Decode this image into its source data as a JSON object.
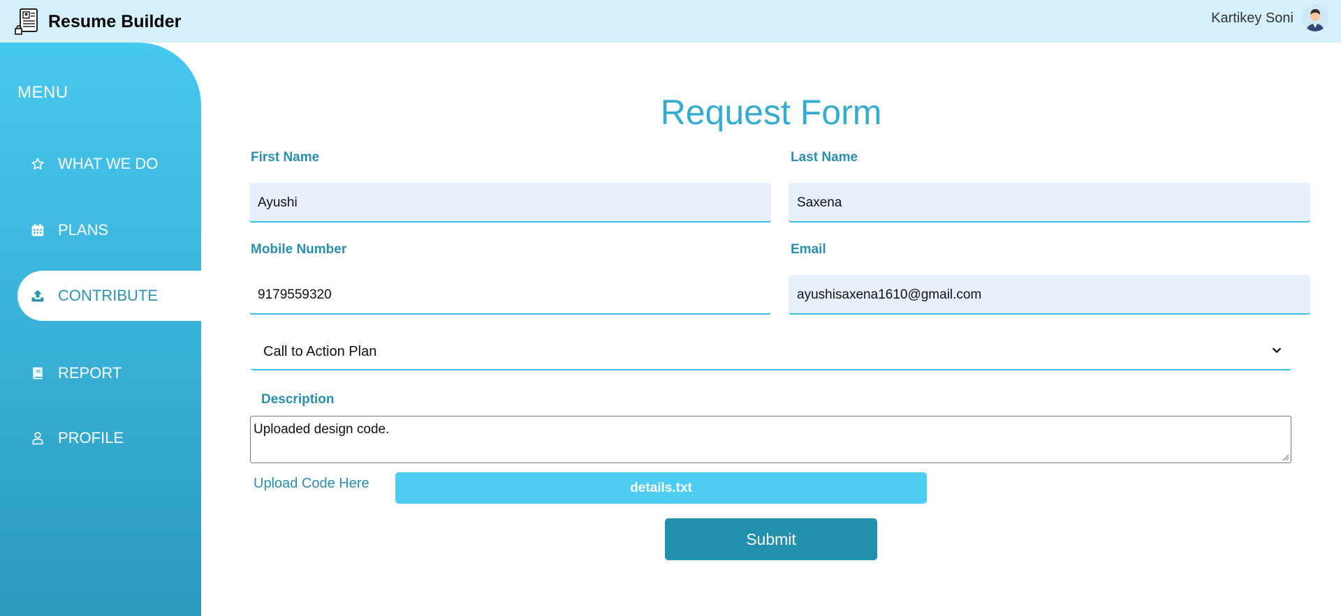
{
  "header": {
    "brand_title": "Resume Builder",
    "user_name": "Kartikey Soni",
    "background": "#d4f0fb"
  },
  "sidebar": {
    "menu_title": "MENU",
    "items": [
      {
        "label": "WHAT WE DO",
        "icon": "star-icon",
        "active": false
      },
      {
        "label": "PLANS",
        "icon": "calendar-icon",
        "active": false
      },
      {
        "label": "CONTRIBUTE",
        "icon": "upload-icon",
        "active": true
      },
      {
        "label": "REPORT",
        "icon": "book-icon",
        "active": false
      },
      {
        "label": "PROFILE",
        "icon": "user-icon",
        "active": false
      }
    ],
    "accent": "#47c8ef"
  },
  "form": {
    "title": "Request Form",
    "first_name_label": "First Name",
    "first_name_value": "Ayushi",
    "last_name_label": "Last Name",
    "last_name_value": "Saxena",
    "mobile_label": "Mobile Number",
    "mobile_value": "9179559320",
    "email_label": "Email",
    "email_value": "ayushisaxena1610@gmail.com",
    "plan_selected": "Call to Action Plan",
    "description_label": "Description",
    "description_value": "Uploaded design code.",
    "upload_label": "Upload Code Here",
    "file_name": "details.txt",
    "submit_label": "Submit",
    "title_color": "#34acd0",
    "label_color": "#2a8fae",
    "button_color": "#218fae"
  }
}
